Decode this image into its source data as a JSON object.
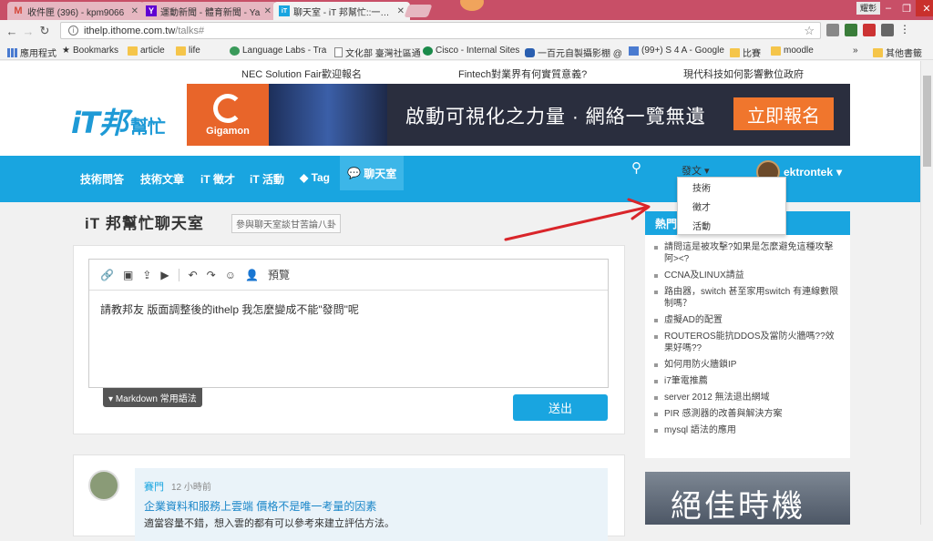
{
  "browser": {
    "tabs": [
      {
        "title": "收件匣 (396) - kpm9066",
        "favicon": "M",
        "color": "#d44638"
      },
      {
        "title": "運動新聞 - 體育新聞 - Ya",
        "favicon": "Y",
        "color": "#6001d2"
      },
      {
        "title": "聊天室 - iT 邦幫忙::一起幫",
        "favicon": "iT",
        "color": "#19a5e0"
      }
    ],
    "window_user": "耀彰",
    "url_host": "ithelp.ithome.com.tw",
    "url_path": "/talks#",
    "bookmarks": [
      {
        "label": "應用程式",
        "icon": "apps-icon"
      },
      {
        "label": "Bookmarks",
        "icon": "star-icon"
      },
      {
        "label": "article",
        "icon": "folder-icon"
      },
      {
        "label": "life",
        "icon": "folder-icon"
      },
      {
        "label": "Language Labs - Tra",
        "icon": "language-icon"
      },
      {
        "label": "文化部 臺灣社區通",
        "icon": "page-icon"
      },
      {
        "label": "Cisco - Internal Sites",
        "icon": "globe-icon"
      },
      {
        "label": "一百元自製攝影棚 @",
        "icon": "chat-icon"
      },
      {
        "label": "(99+) S 4 A - Google",
        "icon": "google-icon"
      },
      {
        "label": "比賽",
        "icon": "folder-icon"
      },
      {
        "label": "moodle",
        "icon": "folder-icon"
      },
      {
        "label": "其他書籤",
        "icon": "folder-icon"
      }
    ]
  },
  "site": {
    "top_links": [
      "NEC Solution Fair歡迎報名",
      "Fintech對業界有何實質意義?",
      "現代科技如何影響數位政府"
    ],
    "logo": {
      "main": "iT邦",
      "sub": "幫忙"
    },
    "banner": {
      "brand": "Gigamon",
      "slogan": "啟動可視化之力量 · 網絡一覽無遺",
      "cta": "立即報名"
    },
    "nav": {
      "items": [
        "技術問答",
        "技術文章",
        "iT 徵才",
        "iT 活動",
        "Tag",
        "聊天室"
      ],
      "post_label": "發文",
      "username": "ektrontek",
      "post_menu": [
        "技術",
        "徵才",
        "活動"
      ]
    },
    "page_title": "iT 邦幫忙聊天室",
    "page_subtitle": "參與聊天室談甘苦論八卦",
    "editor": {
      "preview_label": "預覽",
      "content": "請教邦友 版面調整後的ithelp 我怎麼變成不能\"發問\"呢",
      "markdown_label": "Markdown 常用語法",
      "submit_label": "送出"
    },
    "feed": {
      "user": "賽門",
      "time": "12 小時前",
      "link": "企業資料和服務上雲端 價格不是唯一考量的因素",
      "body": "適當容量不錯，想入雲的都有可以參考來建立評估方法。"
    },
    "hot": {
      "title": "熱門",
      "items": [
        "請問這是被攻擊?如果是怎麼避免這種攻擊阿><?",
        "CCNA及LINUX請益",
        "路由器，switch 甚至家用switch 有連線數限制嗎？",
        "虛擬AD的配置",
        "ROUTEROS能抗DDOS及當防火牆嗎??效果好嗎??",
        "如何用防火牆鎖IP",
        "i7筆電推薦",
        "server 2012 無法退出網域",
        "PIR 感測器的改善與解決方案",
        "mysql 語法的應用"
      ]
    },
    "ad2_text": "絕佳時機"
  },
  "colors": {
    "brand_blue": "#19a5e0",
    "tab_strip": "#c84f67",
    "annotation_arrow": "#d9252a"
  }
}
